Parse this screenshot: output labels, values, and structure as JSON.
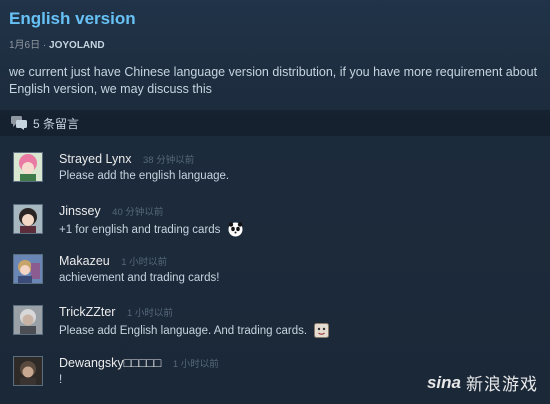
{
  "post": {
    "title": "English version",
    "date": "1月6日",
    "separator": "·",
    "author": "JOYOLAND",
    "body": "we current just have Chinese language version distribution, if you have more requirement about English version, we may discuss this"
  },
  "comments_header": {
    "icon": "chat-bubbles-icon",
    "label": "5 条留言"
  },
  "comments": [
    {
      "name": "Strayed Lynx",
      "time": "38 分钟以前",
      "text": "Please add the english language.",
      "emote": null
    },
    {
      "name": "Jinssey",
      "time": "40 分钟以前",
      "text": "+1 for english and trading cards",
      "emote": "panda-emote"
    },
    {
      "name": "Makazeu",
      "time": "1 小时以前",
      "text": "achievement and trading cards!",
      "emote": null
    },
    {
      "name": "TrickZZter",
      "time": "1 小时以前",
      "text": "Please add English language. And trading cards.",
      "emote": "face-emote"
    },
    {
      "name": "Dewangsky□□□□□",
      "time": "1 小时以前",
      "text": "!",
      "emote": null
    }
  ],
  "watermark": {
    "logo": "sina",
    "text": "新浪游戏"
  }
}
